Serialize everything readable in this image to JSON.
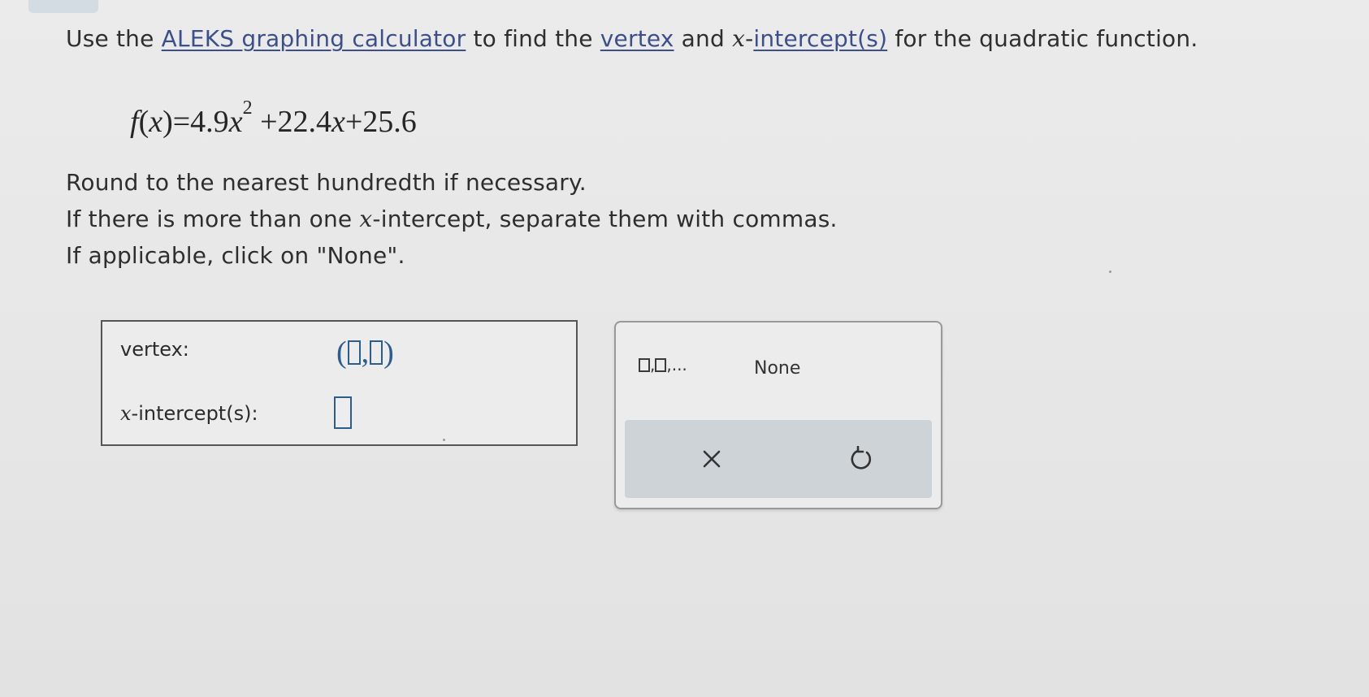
{
  "question": {
    "prefix": "Use the ",
    "calculator_link": "ALEKS graphing calculator",
    "middle1": " to find the ",
    "vertex_link": "vertex",
    "middle2": " and ",
    "x_var": "x",
    "dash": "-",
    "intercept_link": "intercept(s)",
    "suffix": " for the quadratic function."
  },
  "equation": {
    "f": "f",
    "open_paren": "(",
    "x": "x",
    "close_eq": ")=4.9",
    "x2": "x",
    "exponent": "2",
    "term2": "+22.4",
    "x3": "x",
    "term3": "+25.6"
  },
  "instructions": {
    "round": "Round to the nearest hundredth if necessary.",
    "multi_prefix": "If there is more than one ",
    "multi_var": "x",
    "multi_suffix": "-intercept, separate them with commas.",
    "none": "If applicable, click on \"None\"."
  },
  "answer": {
    "vertex_label": "vertex:",
    "vertex_open": "(",
    "vertex_comma": ",",
    "vertex_close": ")",
    "xint_var": "x",
    "xint_label": "-intercept(s):"
  },
  "keypad": {
    "list_comma": ",",
    "list_suffix": ",...",
    "none_label": "None"
  },
  "colors": {
    "link": "#3d4f88",
    "input_border": "#2c5d8c",
    "action_bar": "#cdd3d6"
  },
  "icons": {
    "clear": "x-icon",
    "undo": "undo-icon"
  }
}
